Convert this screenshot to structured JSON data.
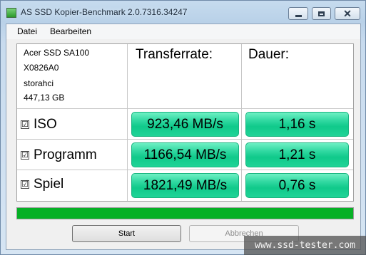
{
  "window": {
    "title": "AS SSD Kopier-Benchmark 2.0.7316.34247",
    "controls": {
      "minimize": "minimize-icon",
      "maximize": "maximize-icon",
      "close": "close-icon"
    }
  },
  "menu": {
    "items": [
      "Datei",
      "Bearbeiten"
    ]
  },
  "drive": {
    "model": "Acer SSD SA100",
    "firmware": "X0826A0",
    "driver": "storahci",
    "size": "447,13 GB"
  },
  "columns": {
    "rate": "Transferrate:",
    "time": "Dauer:"
  },
  "rows": [
    {
      "label": "ISO",
      "checked": true,
      "check_glyph": "☑",
      "rate": "923,46 MB/s",
      "time": "1,16 s"
    },
    {
      "label": "Programm",
      "checked": true,
      "check_glyph": "☑",
      "rate": "1166,54 MB/s",
      "time": "1,21 s"
    },
    {
      "label": "Spiel",
      "checked": true,
      "check_glyph": "☑",
      "rate": "1821,49 MB/s",
      "time": "0,76 s"
    }
  ],
  "progress": {
    "percent": 100,
    "color": "#06b025"
  },
  "buttons": {
    "start": "Start",
    "abort": "Abbrechen",
    "abort_enabled": false
  },
  "result_color": "#20d497",
  "watermark": "www.ssd-tester.com"
}
